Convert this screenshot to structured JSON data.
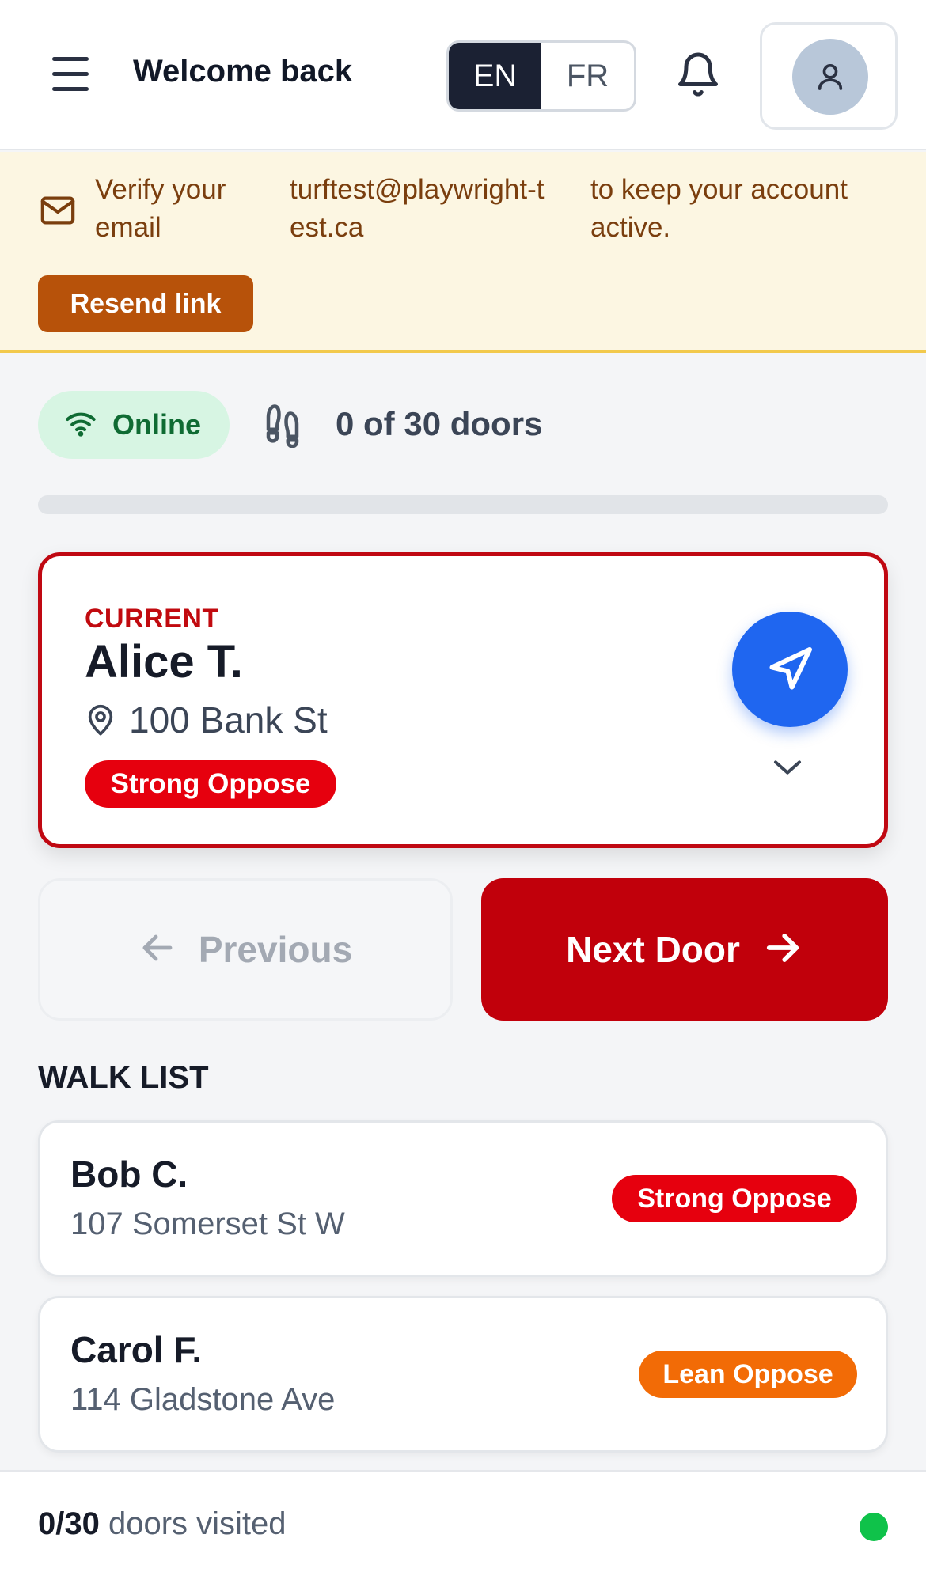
{
  "header": {
    "welcome": "Welcome back",
    "lang_en": "EN",
    "lang_fr": "FR"
  },
  "banner": {
    "text_1": "Verify your email",
    "text_2": "turftest@playwright-test.ca",
    "text_3": "to keep your account active.",
    "resend_label": "Resend link"
  },
  "status": {
    "online_label": "Online",
    "doors_label": "0 of 30 doors",
    "progress_fraction": 0
  },
  "current": {
    "tag": "CURRENT",
    "name": "Alice T.",
    "address": "100 Bank St",
    "badge": "Strong Oppose"
  },
  "nav": {
    "previous_label": "Previous",
    "next_label": "Next Door"
  },
  "walk_list": {
    "title": "WALK LIST",
    "items": [
      {
        "name": "Bob C.",
        "address": "107 Somerset St W",
        "badge": "Strong Oppose"
      },
      {
        "name": "Carol F.",
        "address": "114 Gladstone Ave",
        "badge": "Lean Oppose"
      }
    ]
  },
  "footer": {
    "count": "0/30",
    "label": " doors visited"
  },
  "colors": {
    "accent_red": "#c1000b",
    "strong_oppose": "#e6000e",
    "lean_oppose": "#f26b06",
    "nav_blue": "#1f66f0",
    "online_green": "#0fc24a"
  },
  "icons": [
    "menu-icon",
    "bell-icon",
    "user-icon",
    "mail-icon",
    "wifi-icon",
    "footprints-icon",
    "map-pin-icon",
    "navigation-icon",
    "chevron-down-icon",
    "arrow-left-icon",
    "arrow-right-icon"
  ]
}
